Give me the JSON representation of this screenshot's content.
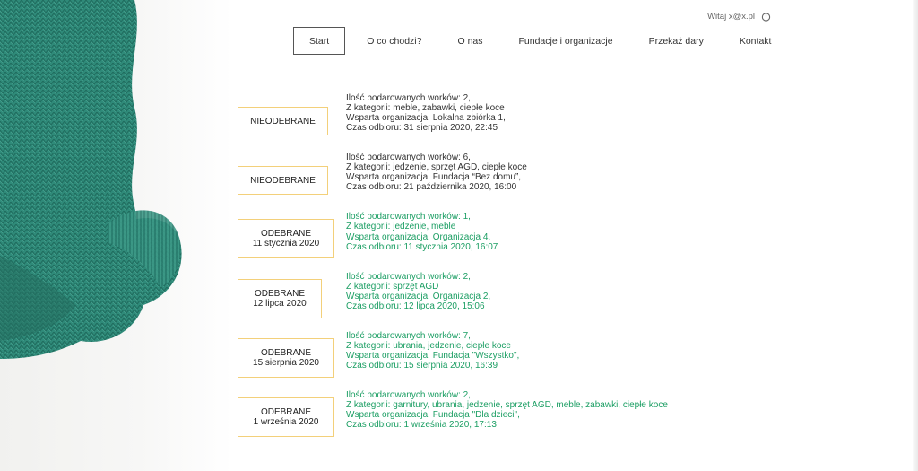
{
  "user": {
    "greeting": "Witaj x@x.pl",
    "logout_icon": "logout-icon"
  },
  "nav": {
    "items": [
      {
        "label": "Start",
        "active": true
      },
      {
        "label": "O co chodzi?"
      },
      {
        "label": "O nas"
      },
      {
        "label": "Fundacje i organizacje"
      },
      {
        "label": "Przekaż dary"
      },
      {
        "label": "Kontakt"
      }
    ]
  },
  "colors": {
    "received": "#1b9e63",
    "pending": "#333333",
    "status_border": "#f3d07a",
    "knit": "#2e8576"
  },
  "donations": [
    {
      "status": "NIEODEBRANE",
      "status_date": "",
      "lines": [
        "Ilość podarowanych worków: 2,",
        "Z kategorii: meble, zabawki, ciepłe koce",
        "Wsparta organizacja: Lokalna zbiórka 1,",
        "Czas odbioru: 31 sierpnia 2020, 22:45"
      ]
    },
    {
      "status": "NIEODEBRANE",
      "status_date": "",
      "lines": [
        "Ilość podarowanych worków: 6,",
        "Z kategorii: jedzenie, sprzęt AGD, ciepłe koce",
        "Wsparta organizacja: Fundacja “Bez domu”,",
        "Czas odbioru: 21 października 2020, 16:00"
      ]
    },
    {
      "status": "ODEBRANE",
      "status_date": "11 stycznia 2020",
      "lines": [
        "Ilość podarowanych worków: 1,",
        "Z kategorii: jedzenie, meble",
        "Wsparta organizacja: Organizacja 4,",
        "Czas odbioru: 11 stycznia 2020, 16:07"
      ]
    },
    {
      "status": "ODEBRANE",
      "status_date": "12 lipca 2020",
      "lines": [
        "Ilość podarowanych worków: 2,",
        "Z kategorii: sprzęt AGD",
        "Wsparta organizacja: Organizacja 2,",
        "Czas odbioru: 12 lipca 2020, 15:06"
      ]
    },
    {
      "status": "ODEBRANE",
      "status_date": "15 sierpnia 2020",
      "lines": [
        "Ilość podarowanych worków: 7,",
        "Z kategorii: ubrania, jedzenie, ciepłe koce",
        "Wsparta organizacja: Fundacja \"Wszystko\",",
        "Czas odbioru: 15 sierpnia 2020, 16:39"
      ]
    },
    {
      "status": "ODEBRANE",
      "status_date": "1 września 2020",
      "lines": [
        "Ilość podarowanych worków: 2,",
        "Z kategorii: garnitury, ubrania, jedzenie, sprzęt AGD, meble, zabawki, ciepłe koce",
        "Wsparta organizacja: Fundacja \"Dla dzieci\",",
        "Czas odbioru: 1 września 2020, 17:13"
      ]
    }
  ]
}
